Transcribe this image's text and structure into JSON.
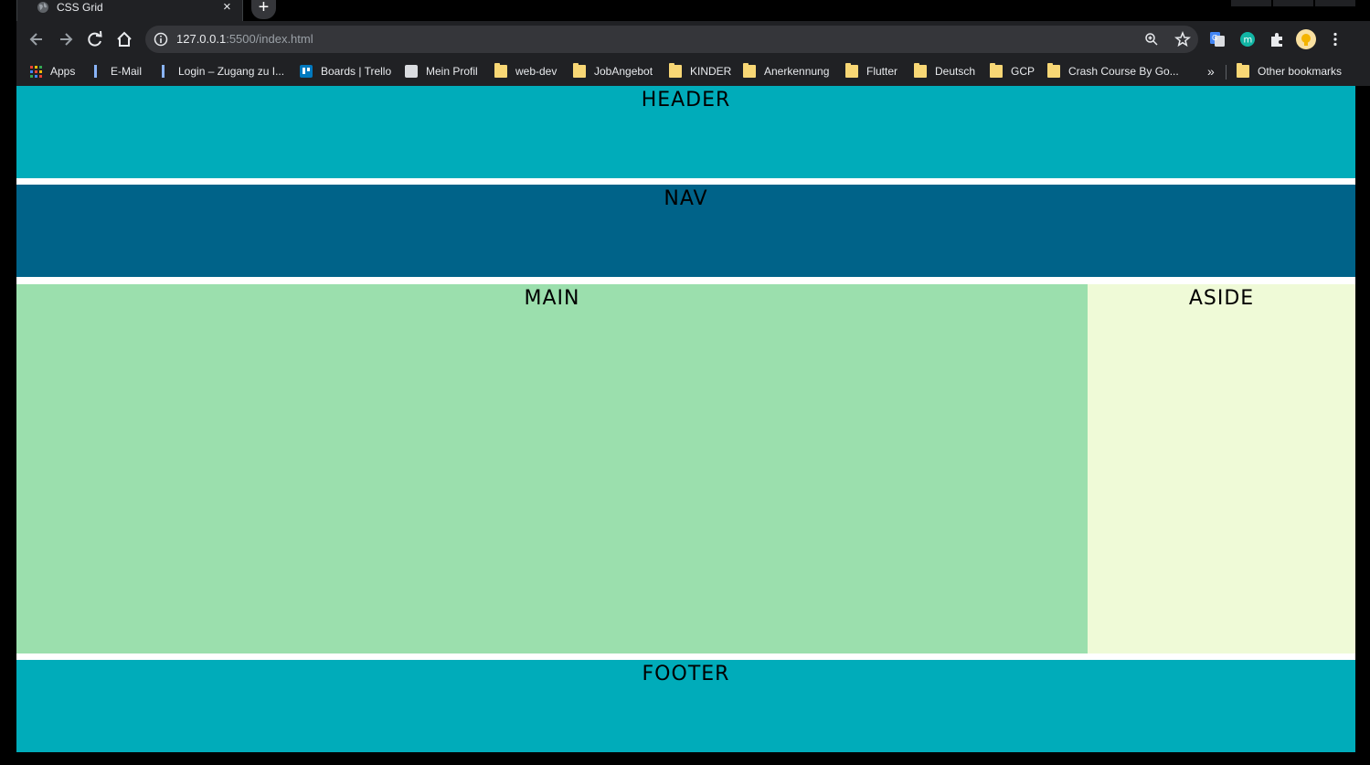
{
  "browser": {
    "tab": {
      "title": "CSS Grid",
      "close_icon": "×"
    },
    "new_tab_icon": "+",
    "url": {
      "host": "127.0.0.1",
      "rest": ":5500/index.html"
    },
    "extensions": [
      "google-translate",
      "m-extension",
      "puzzle-extensions",
      "profile-avatar"
    ],
    "bookmarks": [
      {
        "label": "Apps",
        "icon": "apps-grid"
      },
      {
        "label": "E-Mail",
        "icon": "bar"
      },
      {
        "label": "Login – Zugang zu I...",
        "icon": "bar"
      },
      {
        "label": "Boards | Trello",
        "icon": "trello"
      },
      {
        "label": "Mein Profil",
        "icon": "profile"
      },
      {
        "label": "web-dev",
        "icon": "folder"
      },
      {
        "label": "JobAngebot",
        "icon": "folder"
      },
      {
        "label": "KINDER",
        "icon": "folder"
      },
      {
        "label": "Anerkennung",
        "icon": "folder"
      },
      {
        "label": "Flutter",
        "icon": "folder"
      },
      {
        "label": "Deutsch",
        "icon": "folder"
      },
      {
        "label": "GCP",
        "icon": "folder"
      },
      {
        "label": "Crash Course By Go...",
        "icon": "folder"
      }
    ],
    "overflow_label": "»",
    "other_bookmarks": "Other bookmarks"
  },
  "page": {
    "header": "HEADER",
    "nav": "NAV",
    "main": "MAIN",
    "aside": "ASIDE",
    "footer": "FOOTER"
  },
  "colors": {
    "header": "#00acba",
    "nav": "#006389",
    "main": "#9bdfad",
    "aside": "#effad7",
    "footer": "#00acba"
  }
}
